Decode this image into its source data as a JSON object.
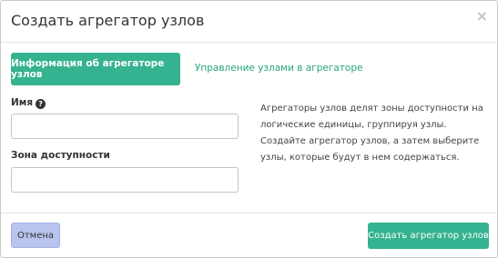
{
  "dialog": {
    "title": "Создать агрегатор узлов",
    "close_icon": "×"
  },
  "tabs": [
    {
      "label": "Информация об агрегаторе узлов",
      "active": true
    },
    {
      "label": "Управление узлами в агрегаторе",
      "active": false
    }
  ],
  "form": {
    "name_label": "Имя",
    "name_help_icon": "?",
    "name_value": "",
    "zone_label": "Зона доступности",
    "zone_value": ""
  },
  "description": "Агрегаторы узлов делят зоны доступности на логические единицы, группируя узлы. Создайте агрегатор узлов, а затем выберите узлы, которые будут в нем содержаться.",
  "footer": {
    "cancel_label": "Отмена",
    "submit_label": "Создать агрегатор узлов"
  },
  "colors": {
    "accent": "#35b28f",
    "link": "#26a47f",
    "cancel_bg": "#b8c4ed"
  }
}
